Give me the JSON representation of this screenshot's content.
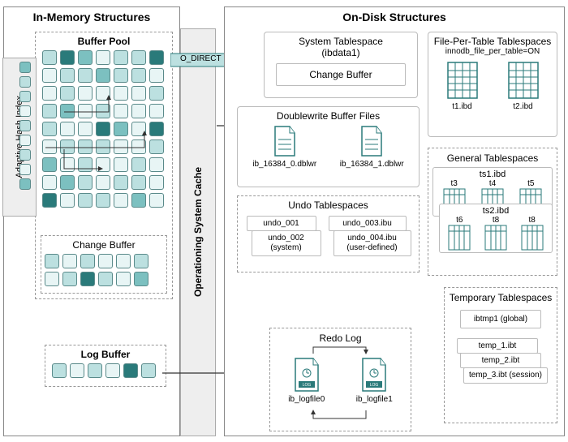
{
  "in_memory": {
    "title": "In-Memory Structures",
    "buffer_pool": {
      "title": "Buffer Pool",
      "adaptive_hash_index": "Adaptive Hash Index",
      "change_buffer": "Change Buffer"
    },
    "log_buffer": {
      "title": "Log Buffer"
    }
  },
  "os_cache": {
    "label": "Operationing System Cache",
    "o_direct": "O_DIRECT"
  },
  "on_disk": {
    "title": "On-Disk Structures",
    "system_tablespace": {
      "title": "System Tablespace",
      "subtitle": "(ibdata1)",
      "change_buffer": "Change Buffer"
    },
    "file_per_table": {
      "title": "File-Per-Table Tablespaces",
      "config": "innodb_file_per_table=ON",
      "files": [
        "t1.ibd",
        "t2.ibd"
      ]
    },
    "doublewrite": {
      "title": "Doublewrite Buffer Files",
      "files": [
        "ib_16384_0.dblwr",
        "ib_16384_1.dblwr"
      ]
    },
    "undo": {
      "title": "Undo Tablespaces",
      "system": [
        "undo_001",
        "undo_002 (system)"
      ],
      "user": [
        "undo_003.ibu",
        "undo_004.ibu (user-defined)"
      ]
    },
    "general": {
      "title": "General Tablespaces",
      "ts1": {
        "name": "ts1.ibd",
        "tables": [
          "t3",
          "t4",
          "t5"
        ]
      },
      "ts2": {
        "name": "ts2.ibd",
        "tables": [
          "t6",
          "t8",
          "t8"
        ]
      }
    },
    "temporary": {
      "title": "Temporary Tablespaces",
      "global": "ibtmp1 (global)",
      "session": [
        "temp_1.ibt",
        "temp_2.ibt",
        "temp_3.ibt (session)"
      ]
    },
    "redo": {
      "title": "Redo Log",
      "files": [
        "ib_logfile0",
        "ib_logfile1"
      ]
    }
  }
}
